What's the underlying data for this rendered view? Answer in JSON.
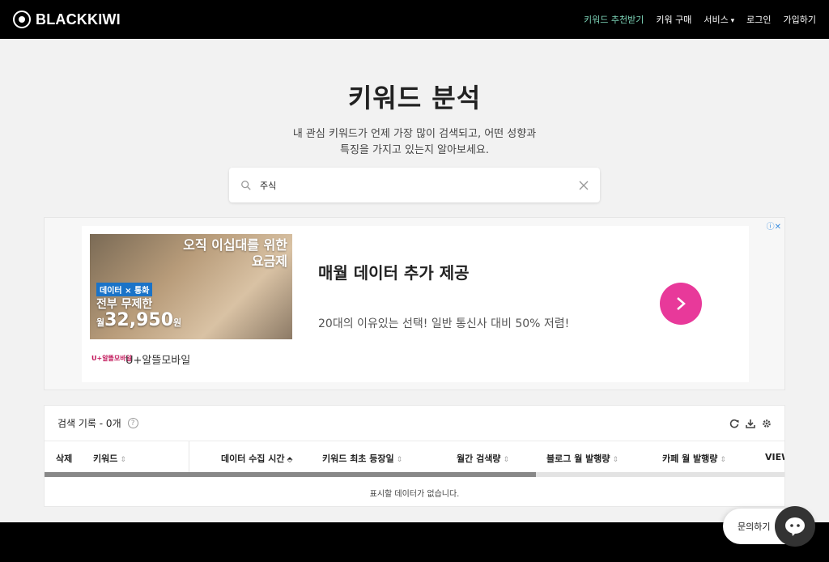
{
  "header": {
    "brand": "BLACKKIWI",
    "nav": [
      {
        "label": "키워드 추천받기",
        "active": true
      },
      {
        "label": "키워 구매",
        "active": false
      },
      {
        "label": "서비스",
        "active": false,
        "dropdown": true
      },
      {
        "label": "로그인",
        "active": false
      },
      {
        "label": "가입하기",
        "active": false
      }
    ]
  },
  "hero": {
    "title": "키워드 분석",
    "subtitle": "내 관심 키워드가 언제 가장 많이 검색되고, 어떤 성향과\n특징을 가지고 있는지 알아보세요."
  },
  "search": {
    "value": "주식"
  },
  "ad": {
    "image_line1": "오직 이십대를 위한",
    "image_line2": "요금제",
    "image_tag": "데이터 × 통화",
    "image_line3": "전부 무제한",
    "image_price_prefix": "월",
    "image_price": "32,950",
    "image_price_unit": "원",
    "brand_logo": "U+알뜰모바일",
    "brand": "U+알뜰모바일",
    "title": "매월 데이터 추가 제공",
    "description": "20대의 이유있는 선택! 일반 통신사 대비 50% 저렴!"
  },
  "records": {
    "title": "검색 기록 - 0개",
    "columns": [
      "삭제",
      "키워드",
      "데이터 수집 시간",
      "키워드 최초 등장일",
      "월간 검색량",
      "블로그 월 발행량",
      "카페 월 발행량",
      "VIEW"
    ],
    "empty_message": "표시할 데이터가 없습니다."
  },
  "chat": {
    "label": "문의하기"
  },
  "colors": {
    "accent": "#7dd4b8",
    "ad_button": "#e8399a"
  }
}
